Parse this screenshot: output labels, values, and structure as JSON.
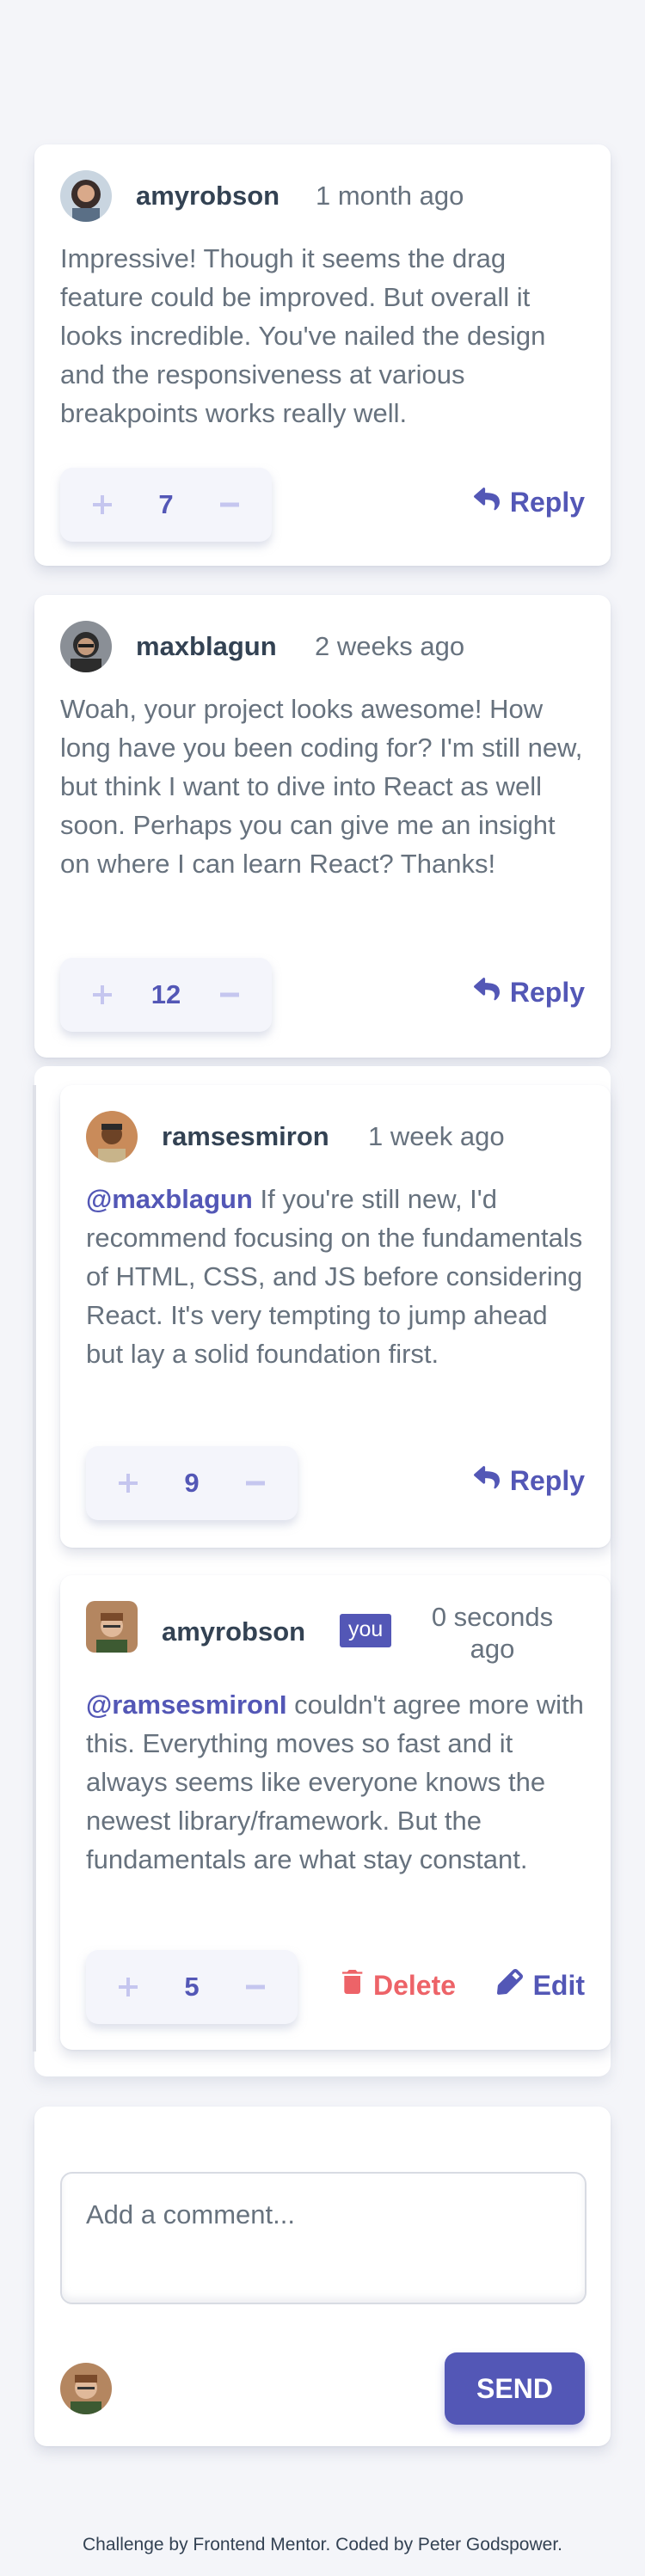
{
  "comments": [
    {
      "username": "amyrobson",
      "time": "1 month ago",
      "content": "Impressive! Though it seems the drag feature could be improved. But overall it looks incredible. You've nailed the design and the responsiveness at various breakpoints works really well.",
      "score": "7",
      "reply_label": "Reply"
    },
    {
      "username": "maxblagun",
      "time": "2 weeks ago",
      "content": "Woah, your project looks awesome! How long have you been coding for? I'm still new, but think I want to dive into React as well soon. Perhaps you can give me an insight on where I can learn React? Thanks!",
      "score": "12",
      "reply_label": "Reply",
      "replies": [
        {
          "username": "ramsesmiron",
          "time": "1 week ago",
          "mention": "@maxblagun",
          "content": " If you're still new, I'd recommend focusing on the fundamentals of HTML, CSS, and JS before considering React. It's very tempting to jump ahead but lay a solid foundation first.",
          "score": "9",
          "reply_label": "Reply"
        },
        {
          "username": "amyrobson",
          "badge": "you",
          "time": "0 seconds ago",
          "mention": "@ramsesmironI",
          "content": " couldn't agree more with this. Everything moves so fast and it always seems like everyone knows the newest library/framework. But the fundamentals are what stay constant.",
          "score": "5",
          "delete_label": "Delete",
          "edit_label": "Edit"
        }
      ]
    }
  ],
  "new_comment": {
    "placeholder": "Add a comment...",
    "send_label": "SEND"
  },
  "footer": "Challenge by Frontend Mentor. Coded by Peter Godspower.",
  "colors": {
    "primary": "#5357b6",
    "danger": "#ed6368",
    "text_dark": "#334253",
    "text": "#67727e",
    "background": "#f4f5f9"
  },
  "icons": {
    "upvote": "plus-icon",
    "downvote": "minus-icon",
    "reply": "reply-arrow-icon",
    "delete": "trash-icon",
    "edit": "pencil-icon"
  }
}
